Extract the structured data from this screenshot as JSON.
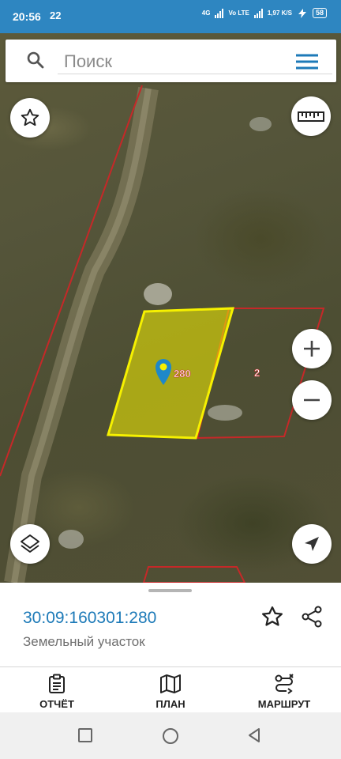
{
  "status": {
    "time": "20:56",
    "notification": "22",
    "net1": "4G",
    "net2": "Vo LTE",
    "speed": "1,97 K/S",
    "battery": "58"
  },
  "search": {
    "placeholder": "Поиск",
    "icon": "search-icon",
    "menu_icon": "menu-icon"
  },
  "map": {
    "selected_parcel_label": "280",
    "neighbor_parcel_label": "2",
    "highlight_color": "#f6f100",
    "boundary_color": "#c62828",
    "controls": [
      "favorite-icon",
      "ruler-icon",
      "zoom-in-icon",
      "zoom-out-icon",
      "layers-icon",
      "locate-icon"
    ]
  },
  "parcel": {
    "cadastral_number": "30:09:160301:280",
    "type": "Земельный участок"
  },
  "bottom_nav": [
    {
      "label": "ОТЧЁТ",
      "icon": "report-icon"
    },
    {
      "label": "ПЛАН",
      "icon": "map-icon"
    },
    {
      "label": "МАРШРУТ",
      "icon": "route-icon"
    }
  ],
  "accent_color": "#1d7ab8",
  "statusbar_color": "#2e86c1"
}
